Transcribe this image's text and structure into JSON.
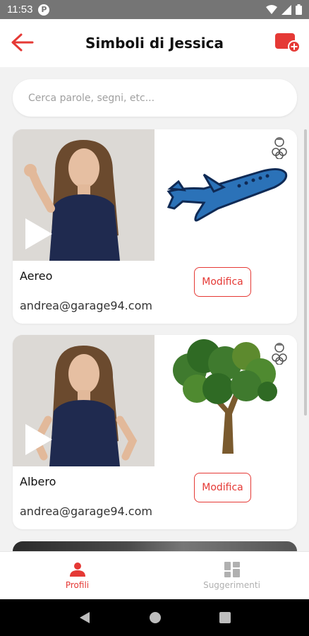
{
  "status_bar": {
    "time": "11:53",
    "app_badge": "P"
  },
  "header": {
    "title": "Simboli di Jessica",
    "accent_color": "#e53935"
  },
  "search": {
    "placeholder": "Cerca parole, segni, etc..."
  },
  "cards": [
    {
      "word": "Aereo",
      "email": "andrea@garage94.com",
      "edit_label": "Modifica",
      "symbol_icon": "airplane-symbol"
    },
    {
      "word": "Albero",
      "email": "andrea@garage94.com",
      "edit_label": "Modifica",
      "symbol_icon": "tree-symbol"
    }
  ],
  "bottom_nav": {
    "tabs": [
      {
        "label": "Profili",
        "icon": "person-icon",
        "active": true
      },
      {
        "label": "Suggerimenti",
        "icon": "grid-icon",
        "active": false
      }
    ]
  }
}
